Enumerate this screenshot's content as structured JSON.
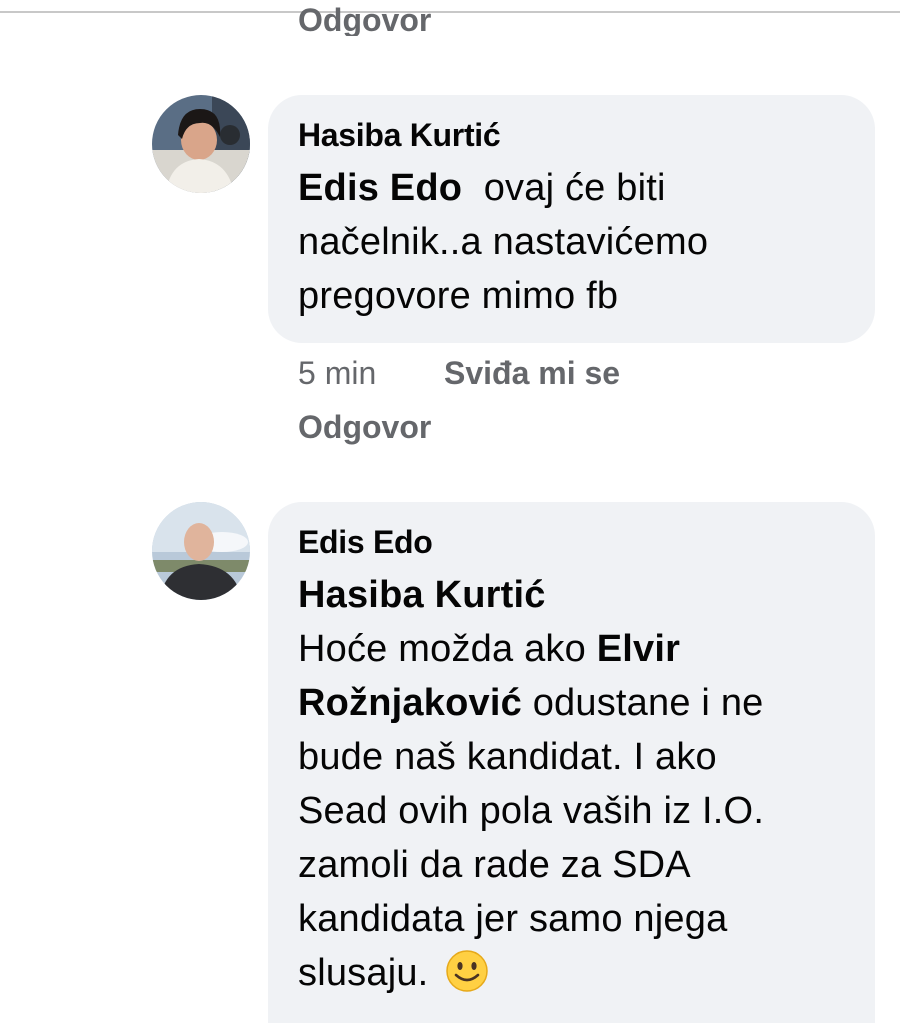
{
  "previous_comment": {
    "reply_label": "Odgovor"
  },
  "comments": [
    {
      "author": "Hasiba Kurtić",
      "mention": "Edis Edo",
      "text_after_mention": "  ovaj će biti",
      "line2": "načelnik..a nastavićemo",
      "line3": "pregovore mimo fb",
      "time": "5 min",
      "like_label": "Sviđa mi se",
      "reply_label": "Odgovor",
      "avatar_icon": "profile-photo-woman"
    },
    {
      "author": "Edis Edo",
      "mention": "Hasiba Kurtić",
      "line1_text": "Hoće možda ako ",
      "mention2_part1": "Elvir",
      "mention2_part2": "Rožnjaković",
      "line2_text": " odustane i ne",
      "line3": "bude naš kandidat. I ako",
      "line4": "Sead ovih pola vaših iz I.O.",
      "line5": "zamoli da rade za SDA",
      "line6": "kandidata jer samo njega",
      "line7": "slusaju.",
      "emoji": "smiling-face-emoji",
      "avatar_icon": "profile-photo-man"
    }
  ],
  "colors": {
    "bubble": "#f0f2f5",
    "meta_text": "#65676b",
    "text": "#050505"
  }
}
